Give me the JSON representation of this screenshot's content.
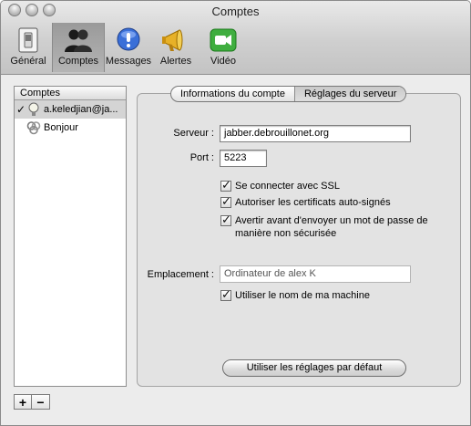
{
  "window": {
    "title": "Comptes"
  },
  "toolbar": {
    "items": [
      {
        "label": "Général",
        "icon": "switch-icon"
      },
      {
        "label": "Comptes",
        "icon": "people-icon",
        "selected": true
      },
      {
        "label": "Messages",
        "icon": "exclamation-bubble-icon"
      },
      {
        "label": "Alertes",
        "icon": "megaphone-icon"
      },
      {
        "label": "Vidéo",
        "icon": "video-camera-icon"
      }
    ]
  },
  "accounts": {
    "header": "Comptes",
    "items": [
      {
        "label": "a.keledjian@ja...",
        "checked_mark": "✓",
        "icon": "lightbulb-icon",
        "selected": true
      },
      {
        "label": "Bonjour",
        "icon": "bonjour-icon"
      }
    ],
    "add_label": "+",
    "remove_label": "−"
  },
  "tabs": [
    {
      "label": "Informations du compte",
      "active": false
    },
    {
      "label": "Réglages du serveur",
      "active": true
    }
  ],
  "server": {
    "server_label": "Serveur :",
    "server_value": "jabber.debrouillonet.org",
    "port_label": "Port :",
    "port_value": "5223",
    "ssl_label": "Se connecter avec SSL",
    "selfsigned_label": "Autoriser les certificats auto-signés",
    "warn_label": "Avertir avant d'envoyer un mot de passe de manière non sécurisée",
    "location_label": "Emplacement :",
    "location_value": "Ordinateur de alex K",
    "machine_label": "Utiliser le nom de ma machine",
    "defaults_button": "Utiliser les réglages par défaut"
  }
}
